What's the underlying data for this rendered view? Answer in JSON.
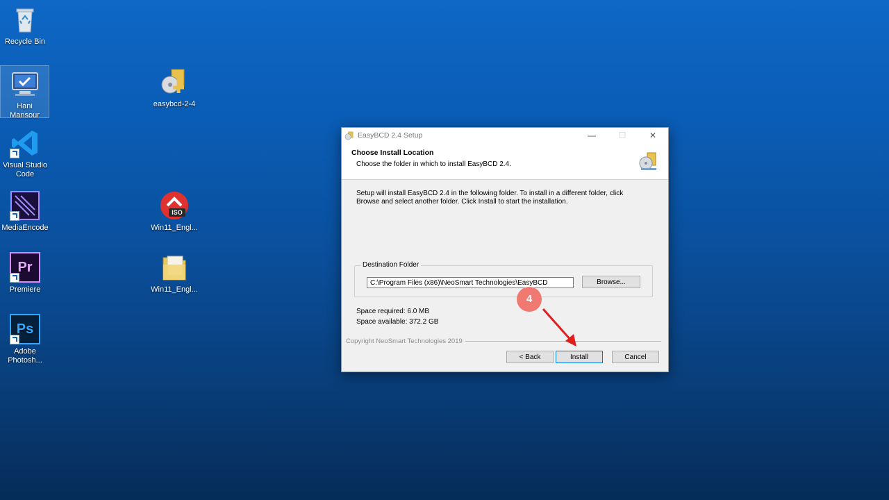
{
  "desktop": {
    "icons": [
      {
        "label": "Recycle Bin",
        "icon": "recycle-bin-icon"
      },
      {
        "label": "Hani\nMansour",
        "icon": "computer-user-icon"
      },
      {
        "label": "Visual Studio\nCode",
        "icon": "vscode-icon"
      },
      {
        "label": "MediaEncode",
        "icon": "media-encoder-icon"
      },
      {
        "label": "Premiere",
        "icon": "premiere-icon",
        "glyph_text": "Pr"
      },
      {
        "label": "Adobe\nPhotosh...",
        "icon": "photoshop-icon",
        "glyph_text": "Ps"
      },
      {
        "label": "easybcd-2-4",
        "icon": "installer-icon"
      },
      {
        "label": "Win11_Engl...",
        "icon": "iso-file-icon",
        "glyph_text": "ISO"
      },
      {
        "label": "Win11_Engl...",
        "icon": "folder-icon"
      }
    ]
  },
  "dialog": {
    "title": "EasyBCD 2.4 Setup",
    "header_title": "Choose Install Location",
    "header_subtitle": "Choose the folder in which to install EasyBCD 2.4.",
    "intro_line1": "Setup will install EasyBCD 2.4 in the following folder. To install in a different folder, click",
    "intro_line2": "Browse and select another folder. Click Install to start the installation.",
    "group_label": "Destination Folder",
    "destination_value": "C:\\Program Files (x86)\\NeoSmart Technologies\\EasyBCD",
    "browse_label": "Browse...",
    "space_required": "Space required: 6.0 MB",
    "space_available": "Space available: 372.2 GB",
    "copyright": "Copyright NeoSmart Technologies 2019",
    "back_label": "< Back",
    "install_label": "Install",
    "cancel_label": "Cancel"
  },
  "annotation": {
    "step_number": "4",
    "badge_color": "#f07a72",
    "arrow_color": "#e01e1e"
  },
  "colors": {
    "desktop_top": "#0f67c6",
    "desktop_bottom": "#062c58",
    "dialog_bg": "#f0f0f0"
  }
}
